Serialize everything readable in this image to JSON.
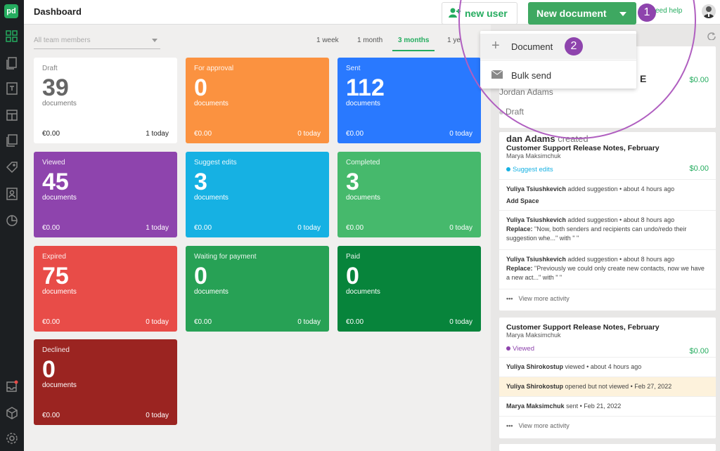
{
  "header": {
    "title": "Dashboard",
    "new_user": "new user",
    "new_document": "New document",
    "help": "eed help"
  },
  "filter": {
    "placeholder": "All team members"
  },
  "ranges": [
    "1 week",
    "1 month",
    "3 months",
    "1 ye"
  ],
  "cards": [
    {
      "label": "Draft",
      "count": "39",
      "sub": "documents",
      "amount": "€0.00",
      "today": "1 today",
      "color": "#ffffff"
    },
    {
      "label": "For approval",
      "count": "0",
      "sub": "documents",
      "amount": "€0.00",
      "today": "0 today",
      "color": "#fb9240"
    },
    {
      "label": "Sent",
      "count": "112",
      "sub": "documents",
      "amount": "€0.00",
      "today": "0 today",
      "color": "#2979ff"
    },
    {
      "label": "Viewed",
      "count": "45",
      "sub": "documents",
      "amount": "€0.00",
      "today": "1 today",
      "color": "#8e44ad"
    },
    {
      "label": "Suggest edits",
      "count": "3",
      "sub": "documents",
      "amount": "€0.00",
      "today": "0 today",
      "color": "#16b1e3"
    },
    {
      "label": "Completed",
      "count": "3",
      "sub": "documents",
      "amount": "€0.00",
      "today": "0 today",
      "color": "#46b96c"
    },
    {
      "label": "Expired",
      "count": "75",
      "sub": "documents",
      "amount": "€0.00",
      "today": "0 today",
      "color": "#e84c48"
    },
    {
      "label": "Waiting for payment",
      "count": "0",
      "sub": "documents",
      "amount": "€0.00",
      "today": "0 today",
      "color": "#27a155"
    },
    {
      "label": "Paid",
      "count": "0",
      "sub": "documents",
      "amount": "€0.00",
      "today": "0 today",
      "color": "#07843b"
    },
    {
      "label": "Declined",
      "count": "0",
      "sub": "documents",
      "amount": "€0.00",
      "today": "0 today",
      "color": "#9b2421"
    }
  ],
  "dropdown": {
    "document": "Document",
    "bulk_send": "Bulk send"
  },
  "badges": {
    "one": "1",
    "two": "2"
  },
  "feed1": {
    "partial_title": "E",
    "author": "Jordan Adams",
    "status": "Draft",
    "amount": "$0.00"
  },
  "feed2": {
    "header_name": "dan Adams",
    "header_action": "created",
    "title": "Customer Support Release Notes, February",
    "owner": "Marya Maksimchuk",
    "status": "Suggest edits",
    "amount": "$0.00",
    "acts": [
      {
        "name": "Yuliya Tsiushkevich",
        "text": "added suggestion • about 4 hours ago",
        "detail_bold": "Add Space",
        "detail": ""
      },
      {
        "name": "Yuliya Tsiushkevich",
        "text": "added suggestion • about 8 hours ago",
        "detail_bold": "Replace:",
        "detail": "\"Now, both senders and recipients can undo/redo their suggestion whe...\" with \" \""
      },
      {
        "name": "Yuliya Tsiushkevich",
        "text": "added suggestion • about 8 hours ago",
        "detail_bold": "Replace:",
        "detail": "\"Previously we could only create new contacts, now we have a new act...\" with \" \""
      }
    ],
    "more": "View more activity"
  },
  "feed3": {
    "title": "Customer Support Release Notes, February",
    "owner": "Marya Maksimchuk",
    "status": "Viewed",
    "amount": "$0.00",
    "acts": [
      {
        "name": "Yuliya Shirokostup",
        "text": "viewed • about 4 hours ago"
      },
      {
        "name": "Yuliya Shirokostup",
        "text": "opened but not viewed • Feb 27, 2022"
      },
      {
        "name": "Marya Maksimchuk",
        "text": "sent • Feb 21, 2022"
      }
    ],
    "more": "View more activity"
  },
  "colors": {
    "accent": "#25ac5f",
    "highlight": "#8e44ad",
    "sidebar": "#1c1f22"
  }
}
